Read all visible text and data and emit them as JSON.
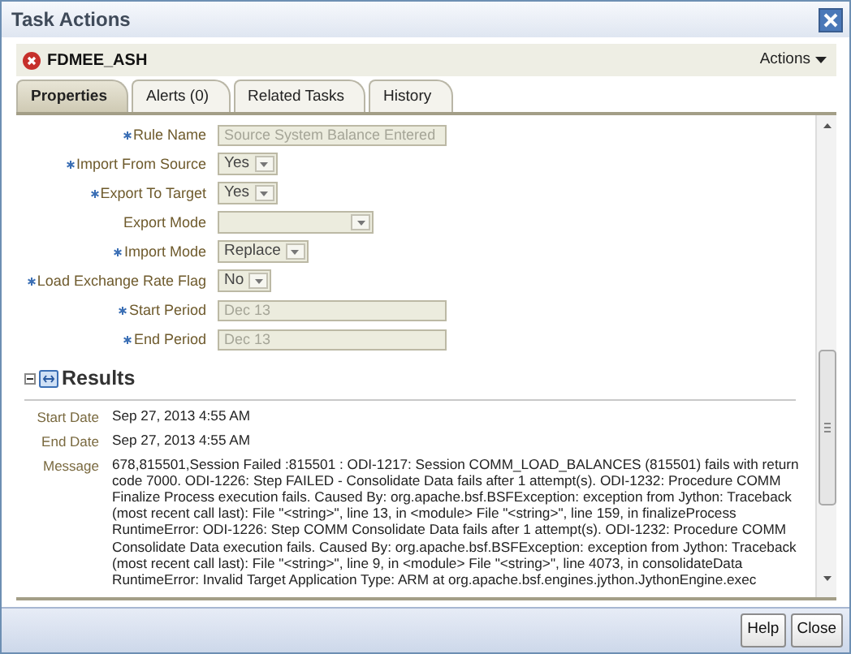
{
  "window": {
    "title": "Task Actions"
  },
  "task": {
    "name": "FDMEE_ASH",
    "failed": true,
    "actions_menu": "Actions"
  },
  "tabs": [
    {
      "label": "Properties",
      "selected": true
    },
    {
      "label": "Alerts (0)",
      "selected": false
    },
    {
      "label": "Related Tasks",
      "selected": false
    },
    {
      "label": "History",
      "selected": false
    }
  ],
  "properties": [
    {
      "label": "Rule Name",
      "required": true,
      "kind": "text",
      "disabled": true,
      "value": "Source System Balance Entered"
    },
    {
      "label": "Import From Source",
      "required": true,
      "kind": "select",
      "value": "Yes"
    },
    {
      "label": "Export To Target",
      "required": true,
      "kind": "select",
      "value": "Yes"
    },
    {
      "label": "Export Mode",
      "required": false,
      "kind": "select"
    },
    {
      "label": "Import Mode",
      "required": true,
      "kind": "select",
      "value": "Replace"
    },
    {
      "label": "Load Exchange Rate Flag",
      "required": true,
      "kind": "select",
      "value": "No"
    },
    {
      "label": "Start Period",
      "required": true,
      "kind": "text",
      "disabled": true,
      "value": "Dec 13"
    },
    {
      "label": "End Period",
      "required": true,
      "kind": "text",
      "disabled": true,
      "value": "Dec 13"
    }
  ],
  "results": {
    "title": "Results",
    "expanded": true,
    "rows": [
      {
        "label": "Start Date",
        "lines": [
          "Sep 27, 2013 4:55 AM"
        ]
      },
      {
        "label": "End Date",
        "lines": [
          "Sep 27, 2013 4:55 AM"
        ]
      },
      {
        "label": "Message",
        "lines": [
          "678,815501,Session Failed :815501 : ODI-1217: Session COMM_LOAD_BALANCES (815501) fails with return",
          "code 7000. ODI-1226: Step FAILED - Consolidate Data fails after 1 attempt(s). ODI-1232: Procedure COMM",
          "Finalize Process execution fails. Caused By: org.apache.bsf.BSFException: exception from Jython: Traceback",
          "(most recent call last): File \"<string>\", line 13, in <module> File \"<string>\", line 159, in finalizeProcess",
          "RuntimeError: ODI-1226: Step COMM Consolidate Data fails after 1 attempt(s). ODI-1232: Procedure COMM",
          "Consolidate Data execution fails. Caused By: org.apache.bsf.BSFException: exception from Jython: Traceback",
          "(most recent call last): File \"<string>\", line 9, in <module> File \"<string>\", line 4073, in consolidateData",
          "RuntimeError: Invalid Target Application Type: ARM at org.apache.bsf.engines.jython.JythonEngine.exec"
        ]
      }
    ]
  },
  "buttons": [
    "Help",
    "Close"
  ]
}
